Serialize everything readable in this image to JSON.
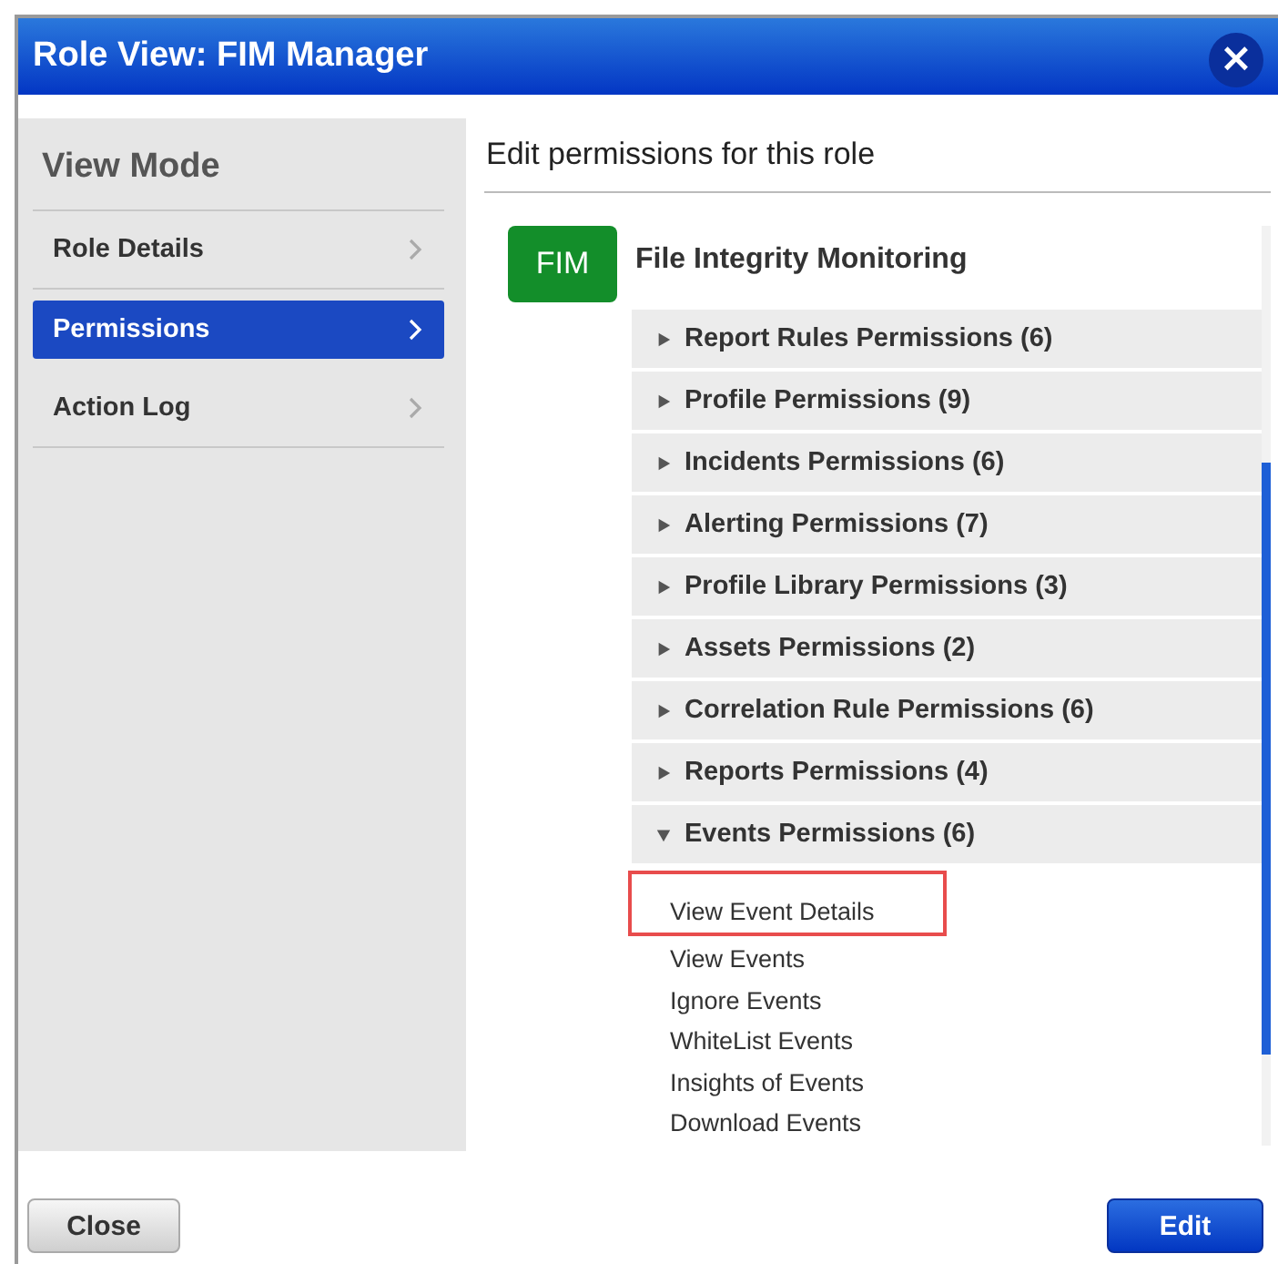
{
  "window": {
    "title": "Role View: FIM Manager",
    "close_button": "×"
  },
  "sidebar": {
    "title": "View Mode",
    "items": [
      {
        "label": "Role Details",
        "selected": false
      },
      {
        "label": "Permissions",
        "selected": true
      },
      {
        "label": "Action Log",
        "selected": false
      }
    ]
  },
  "content": {
    "heading": "Edit permissions for this role",
    "module": {
      "badge": "FIM",
      "title": "File Integrity Monitoring",
      "groups": [
        {
          "label": "Report Rules Permissions (6)",
          "expanded": false
        },
        {
          "label": "Profile Permissions (9)",
          "expanded": false
        },
        {
          "label": "Incidents Permissions (6)",
          "expanded": false
        },
        {
          "label": "Alerting Permissions (7)",
          "expanded": false
        },
        {
          "label": "Profile Library Permissions (3)",
          "expanded": false
        },
        {
          "label": "Assets Permissions (2)",
          "expanded": false
        },
        {
          "label": "Correlation Rule Permissions (6)",
          "expanded": false
        },
        {
          "label": "Reports Permissions (4)",
          "expanded": false
        },
        {
          "label": "Events Permissions (6)",
          "expanded": true,
          "children": [
            {
              "label": "View Event Details",
              "highlighted": true
            },
            {
              "label": "View Events",
              "highlighted": false
            },
            {
              "label": "Ignore Events",
              "highlighted": false
            },
            {
              "label": "WhiteList Events",
              "highlighted": false
            },
            {
              "label": "Insights of Events",
              "highlighted": false
            },
            {
              "label": "Download Events",
              "highlighted": false
            }
          ]
        }
      ]
    }
  },
  "buttons": [
    {
      "label": "Close",
      "kind": "secondary"
    },
    {
      "label": "Edit",
      "kind": "primary"
    }
  ]
}
